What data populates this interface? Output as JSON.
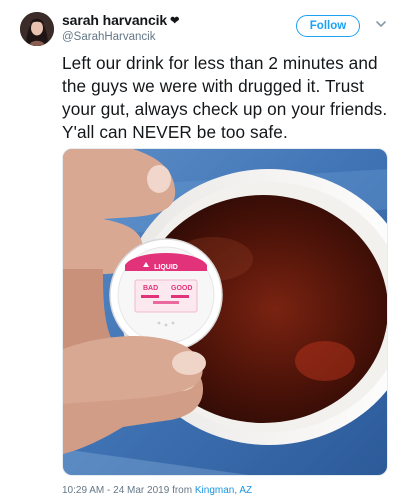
{
  "user": {
    "display_name": "sarah harvancik",
    "handle": "@SarahHarvancik",
    "badge_icon": "heart-icon"
  },
  "actions": {
    "follow_label": "Follow"
  },
  "tweet": {
    "text": "Left our drink for less than 2 minutes and the guys we were with drugged it. Trust your gut, always check up on your friends. Y'all can NEVER be too safe.",
    "timestamp": "10:29 AM - 24 Mar 2019 from",
    "location": "Kingman, AZ"
  },
  "media": {
    "test_strip": {
      "label": "LIQUID",
      "bad_label": "BAD",
      "good_label": "GOOD"
    }
  },
  "colors": {
    "accent": "#1da1f2",
    "text": "#14171a",
    "muted": "#657786",
    "link": "#1b95e0",
    "drink": "#4a1208",
    "test_pink": "#e2337a"
  }
}
